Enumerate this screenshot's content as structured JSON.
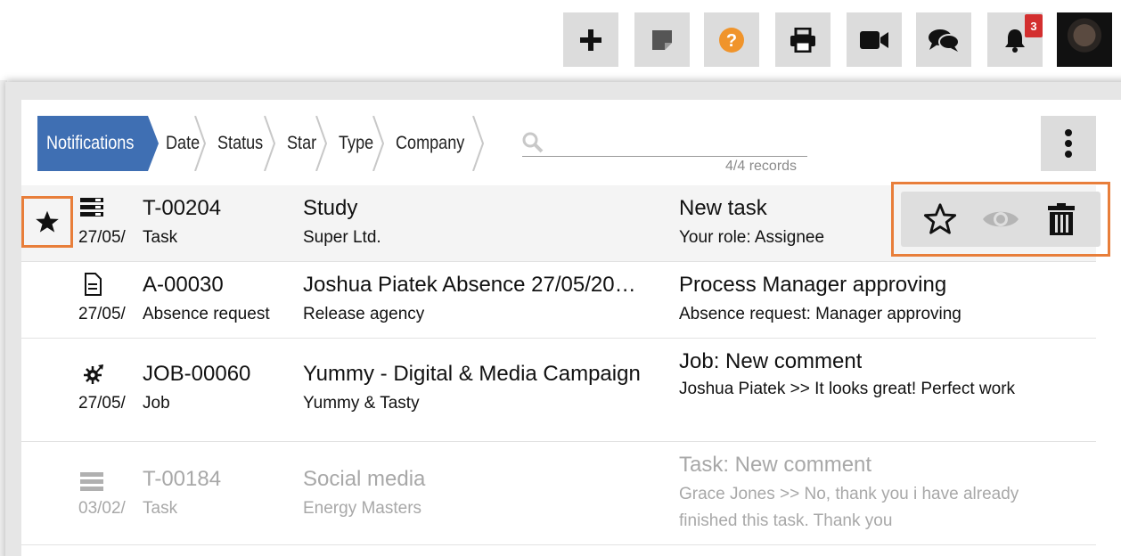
{
  "toolbar": {
    "buttons": [
      {
        "name": "add-button",
        "icon": "plus-icon"
      },
      {
        "name": "sticky-note-button",
        "icon": "note-icon"
      },
      {
        "name": "help-button",
        "icon": "help-icon"
      },
      {
        "name": "print-button",
        "icon": "printer-icon"
      },
      {
        "name": "video-button",
        "icon": "video-icon"
      },
      {
        "name": "chat-button",
        "icon": "chat-icon"
      },
      {
        "name": "notifications-button",
        "icon": "bell-icon"
      }
    ],
    "notification_count": "3",
    "help_color": "#f0942b",
    "badge_color": "#d32f2f"
  },
  "filters": {
    "tabs": [
      "Notifications",
      "Date",
      "Status",
      "Star",
      "Type",
      "Company"
    ],
    "active_color": "#3f6fb3"
  },
  "search": {
    "value": "",
    "placeholder": "",
    "records": "4/4 records"
  },
  "notifications": [
    {
      "ref": "T-00204",
      "date": "27/05/",
      "type": "Task",
      "type_icon": "task-icon",
      "title": "Study",
      "company": "Super Ltd.",
      "event": "New task",
      "detail": "Your role: Assignee",
      "starred": true,
      "read": false,
      "highlighted": true
    },
    {
      "ref": "A-00030",
      "date": "27/05/",
      "type": "Absence request",
      "type_icon": "document-icon",
      "title": "Joshua Piatek Absence 27/05/20…",
      "company": "Release agency",
      "event": "Process Manager approving",
      "detail": "Absence request: Manager approving",
      "starred": false,
      "read": false
    },
    {
      "ref": "JOB-00060",
      "date": "27/05/",
      "type": "Job",
      "type_icon": "job-icon",
      "title": "Yummy - Digital & Media Campaign",
      "company": "Yummy & Tasty",
      "event": "Job: New comment",
      "detail": "Joshua Piatek >> It looks great! Perfect work",
      "starred": false,
      "read": false
    },
    {
      "ref": "T-00184",
      "date": "03/02/",
      "type": "Task",
      "type_icon": "task-icon",
      "title": "Social media",
      "company": "Energy Masters",
      "event": "Task: New comment",
      "detail": "Grace Jones >> No, thank you i have already",
      "detail2": "finished this task. Thank you",
      "starred": false,
      "read": true
    }
  ],
  "highlight_color": "#e87e3a"
}
